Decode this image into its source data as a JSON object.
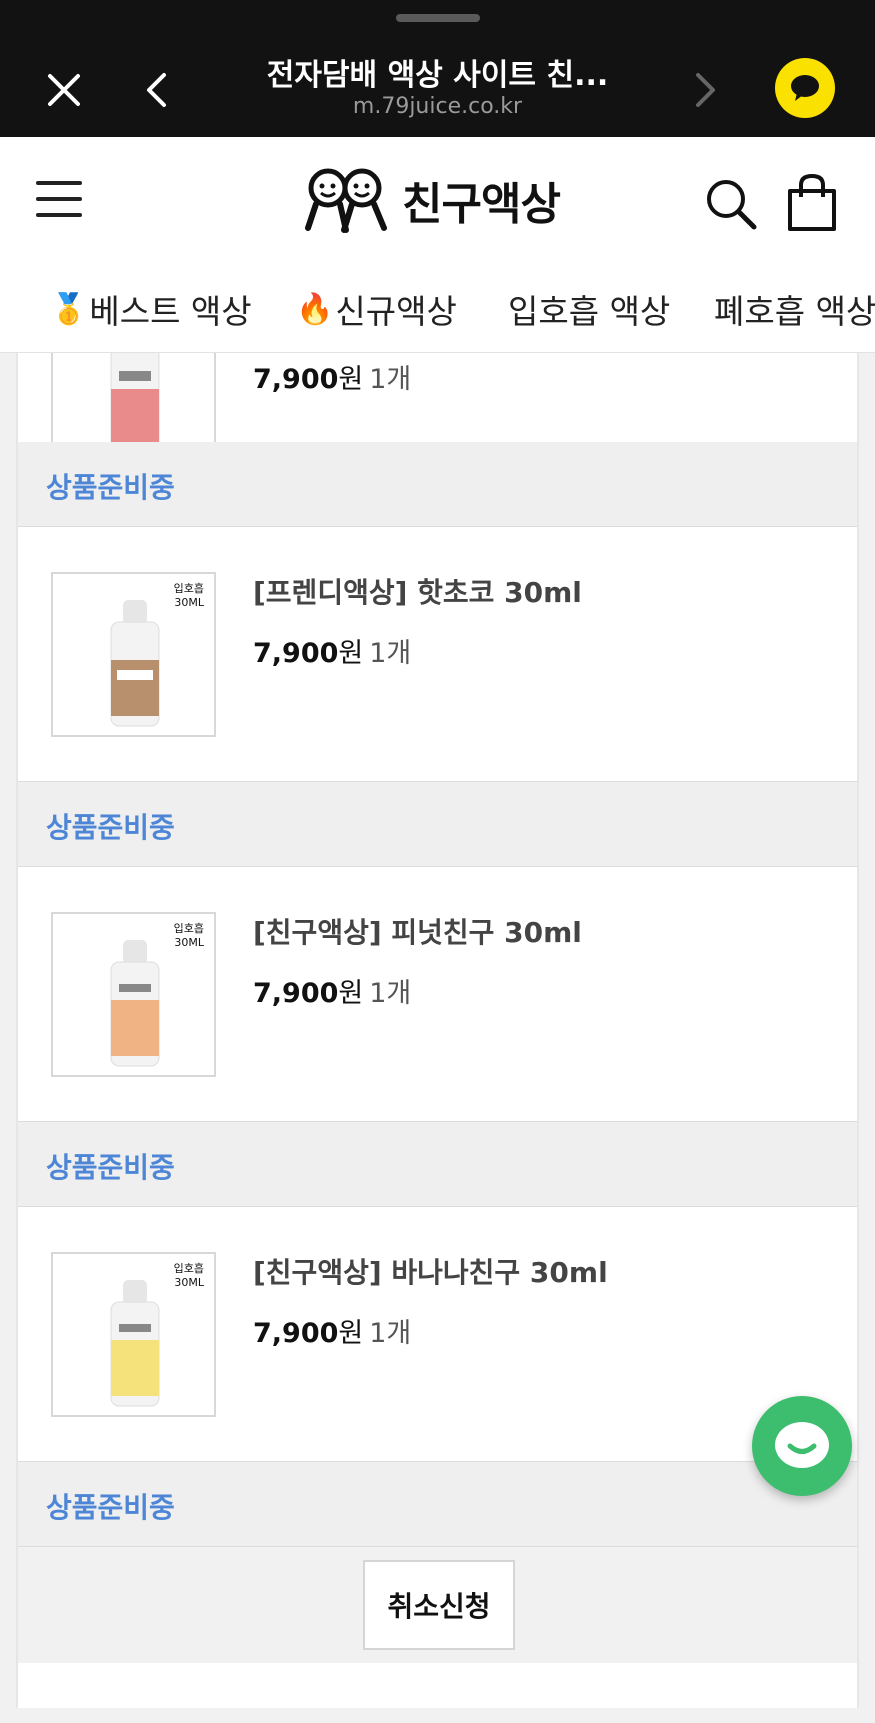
{
  "browser": {
    "title": "전자담배 액상 사이트 친...",
    "url": "m.79juice.co.kr",
    "icons": [
      "close-icon",
      "back-icon",
      "forward-icon",
      "kakao-chat-icon"
    ]
  },
  "header": {
    "logo_text": "친구액상",
    "icons": [
      "menu-icon",
      "search-icon",
      "cart-icon"
    ]
  },
  "categories": [
    {
      "emoji": "🥇",
      "label": "베스트 액상"
    },
    {
      "emoji": "🔥",
      "label": "신규액상"
    },
    {
      "emoji": "",
      "label": "입호흡 액상"
    },
    {
      "emoji": "",
      "label": "폐호흡 액상"
    }
  ],
  "orders": [
    {
      "name": "",
      "price": "7,900",
      "won": "원",
      "qty": "1개",
      "status": "상품준비중",
      "bottle_color": "#e98b8b",
      "tag": ""
    },
    {
      "name": "[프렌디액상] 핫초코 30ml",
      "price": "7,900",
      "won": "원",
      "qty": "1개",
      "status": "상품준비중",
      "bottle_color": "#b8906e",
      "tag": "입호흡\n30ML"
    },
    {
      "name": "[친구액상] 피넛친구 30ml",
      "price": "7,900",
      "won": "원",
      "qty": "1개",
      "status": "상품준비중",
      "bottle_color": "#f0b384",
      "tag": "입호흡\n30ML"
    },
    {
      "name": "[친구액상] 바나나친구 30ml",
      "price": "7,900",
      "won": "원",
      "qty": "1개",
      "status": "상품준비중",
      "bottle_color": "#f6e27a",
      "tag": "입호흡\n30ML"
    }
  ],
  "actions": {
    "cancel_label": "취소신청"
  },
  "colors": {
    "status_blue": "#4d86d6",
    "kakao_yellow": "#fae100",
    "chat_green": "#3dbd6e"
  }
}
